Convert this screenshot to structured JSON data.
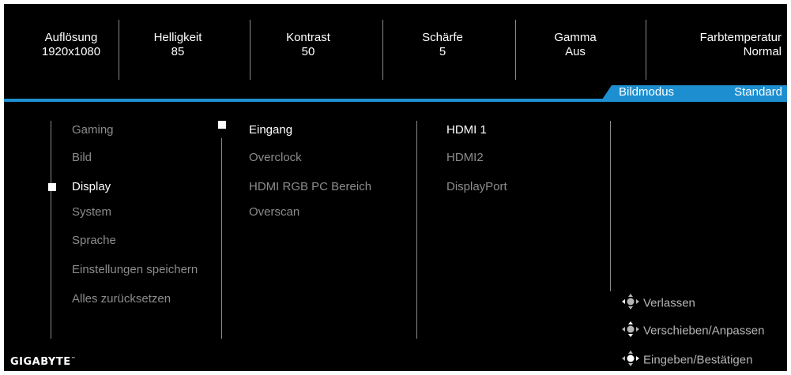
{
  "status_bar": {
    "items": [
      {
        "label": "Auflösung",
        "value": "1920x1080"
      },
      {
        "label": "Helligkeit",
        "value": "85"
      },
      {
        "label": "Kontrast",
        "value": "50"
      },
      {
        "label": "Schärfe",
        "value": "5"
      },
      {
        "label": "Gamma",
        "value": "Aus"
      },
      {
        "label": "Farbtemperatur",
        "value": "Normal"
      }
    ]
  },
  "mode_tab": {
    "label": "Bildmodus",
    "value": "Standard"
  },
  "menu": {
    "main": [
      "Gaming",
      "Bild",
      "Display",
      "System",
      "Sprache",
      "Einstellungen speichern",
      "Alles zurücksetzen"
    ],
    "sub": [
      "Eingang",
      "Overclock",
      "HDMI RGB PC Bereich",
      "Overscan"
    ],
    "options": [
      "HDMI 1",
      "HDMI2",
      "DisplayPort"
    ]
  },
  "hints": [
    "Verlassen",
    "Verschieben/Anpassen",
    "Eingeben/Bestätigen"
  ],
  "logo": {
    "text": "GIGABYTE",
    "mark": "™"
  },
  "colors": {
    "accent": "#1d8fd0",
    "background": "#000000",
    "inactive_text": "#8c8c8c",
    "active_text": "#ffffff"
  }
}
